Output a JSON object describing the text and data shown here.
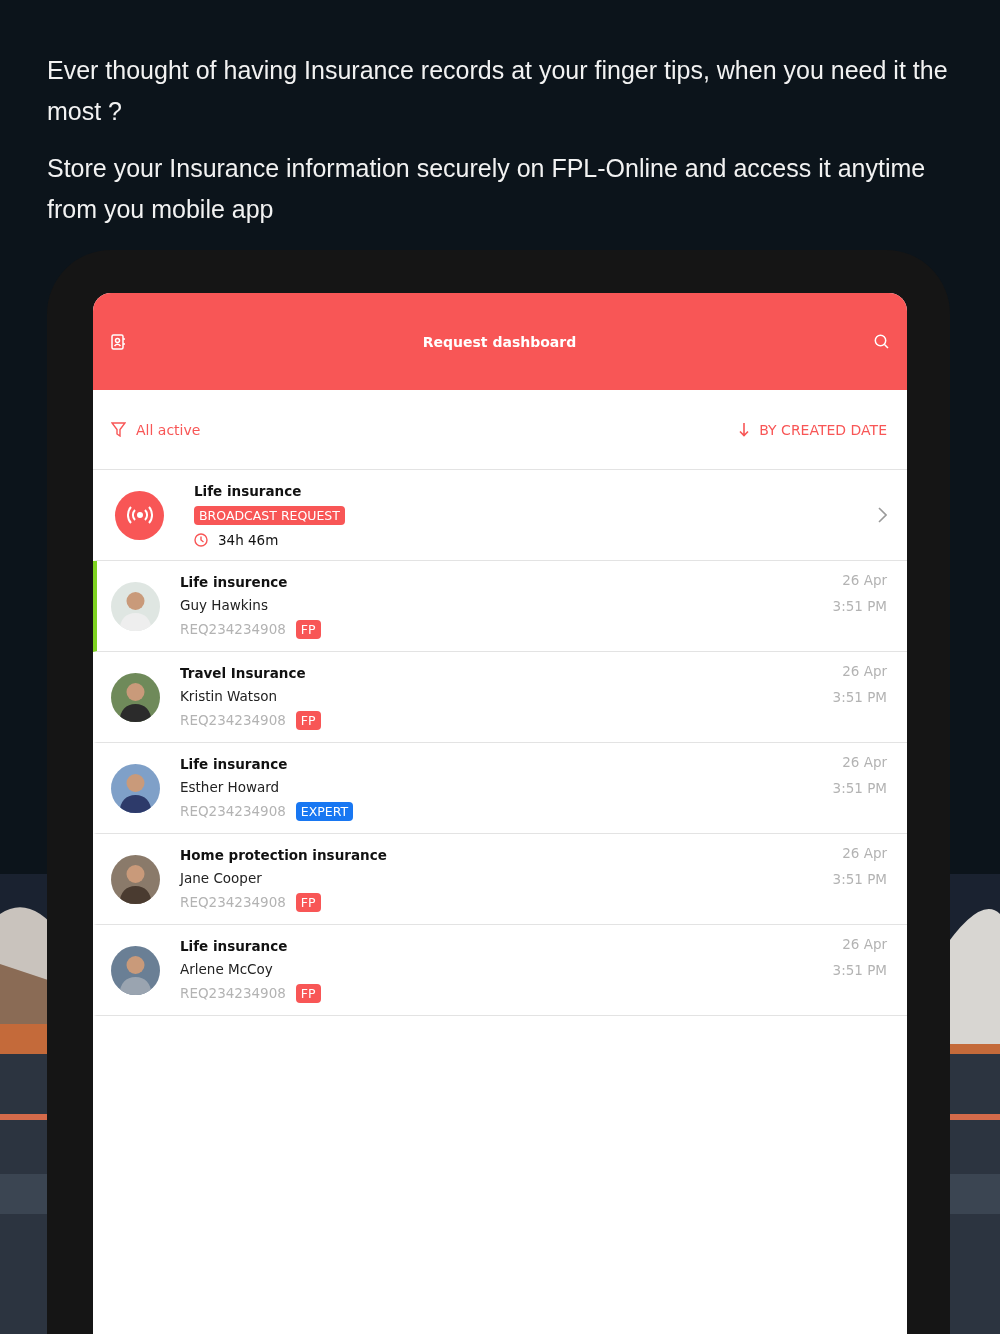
{
  "intro": [
    "Ever thought of having Insurance records at your finger tips, when you need it the most ?",
    "Store your Insurance information securely on FPL-Online and access it anytime from you mobile app"
  ],
  "app_bar": {
    "title": "Request dashboard"
  },
  "filter": {
    "label": "All active",
    "sort": "BY CREATED DATE"
  },
  "broadcast": {
    "title": "Life insurance",
    "badge": "BROADCAST REQUEST",
    "timer": "34h 46m"
  },
  "requests": [
    {
      "title": "Life insurence",
      "name": "Guy Hawkins",
      "id": "REQ234234908",
      "tag": "FP",
      "color": "#f85656",
      "date": "26 Apr",
      "time": "3:51 PM",
      "selected": true
    },
    {
      "title": "Travel Insurance",
      "name": "Kristin Watson",
      "id": "REQ234234908",
      "tag": "FP",
      "color": "#f85656",
      "date": "26 Apr",
      "time": "3:51 PM",
      "selected": false
    },
    {
      "title": "Life insurance",
      "name": "Esther Howard",
      "id": "REQ234234908",
      "tag": "EXPERT",
      "color": "#1877f2",
      "date": "26 Apr",
      "time": "3:51 PM",
      "selected": false
    },
    {
      "title": "Home protection insurance",
      "name": "Jane Cooper",
      "id": "REQ234234908",
      "tag": "FP",
      "color": "#f85656",
      "date": "26 Apr",
      "time": "3:51 PM",
      "selected": false
    },
    {
      "title": "Life insurance",
      "name": "Arlene McCoy",
      "id": "REQ234234908",
      "tag": "FP",
      "color": "#f85656",
      "date": "26 Apr",
      "time": "3:51 PM",
      "selected": false
    }
  ]
}
